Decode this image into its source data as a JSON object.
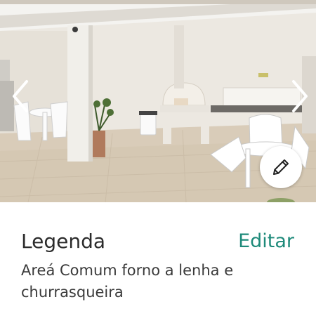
{
  "photo": {
    "icon": "gallery-photo",
    "prev_icon": "chevron-left-icon",
    "next_icon": "chevron-right-icon",
    "edit_icon": "pencil-icon"
  },
  "caption": {
    "title": "Legenda",
    "edit_label": "Editar",
    "text": "Areá Comum forno a lenha e churrasqueira"
  },
  "colors": {
    "accent": "#1e8a7a",
    "title_text": "#2b2b2b",
    "body_text": "#3a3a3a"
  }
}
